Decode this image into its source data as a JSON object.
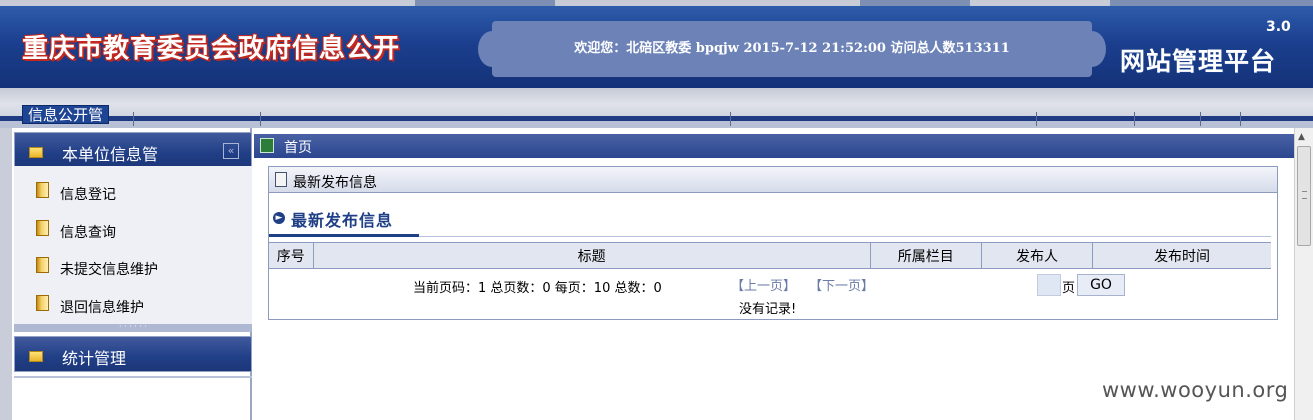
{
  "header": {
    "site_title": "重庆市教育委员会政府信息公开",
    "welcome_text": "欢迎您：北碚区教委   bpqjw   2015-7-12 21:52:00   访问总人数513311",
    "version": "3.0",
    "platform_name": "网站管理平台"
  },
  "tabs": [
    {
      "label": "信息公开管"
    }
  ],
  "sidebar": {
    "section1_title": "本单位信息管",
    "items": [
      {
        "label": "信息登记"
      },
      {
        "label": "信息查询"
      },
      {
        "label": "未提交信息维护"
      },
      {
        "label": "退回信息维护"
      }
    ],
    "section2_title": "统计管理"
  },
  "main": {
    "breadcrumb": "首页",
    "panel_title": "最新发布信息",
    "subtitle": "最新发布信息",
    "columns": [
      "序号",
      "标题",
      "所属栏目",
      "发布人",
      "发布时间"
    ],
    "pager": {
      "info": "当前页码：1 总页数：0 每页：10 总数：0",
      "prev": "【上一页】",
      "next": "【下一页】",
      "page_label": "页",
      "go": "GO"
    },
    "empty_text": "没有记录!"
  },
  "watermark": "www.wooyun.org",
  "colors": {
    "header_blue": "#1b3f8e",
    "title_red_outline": "#c2281f",
    "accent_navy": "#1f3f86"
  }
}
